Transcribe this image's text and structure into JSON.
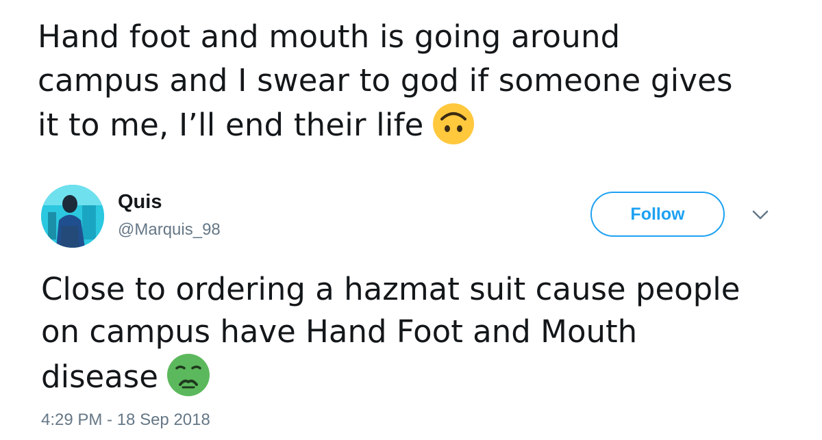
{
  "previous_tweet": {
    "lines": [
      "Hand foot and mouth is going around",
      "campus and I swear to god if someone gives",
      "it to me, I’ll end their life"
    ],
    "emoji": "upside-down-face-icon"
  },
  "reply": {
    "user": {
      "name": "Quis",
      "handle": "@Marquis_98"
    },
    "follow_label": "Follow",
    "menu_icon": "chevron-down-icon",
    "lines": [
      "Close to ordering a hazmat suit cause people",
      "on campus have Hand Foot and Mouth",
      "disease"
    ],
    "emoji": "nauseated-face-icon",
    "timestamp": "4:29 PM - 18 Sep 2018"
  },
  "colors": {
    "text": "#14171a",
    "secondary_text": "#657786",
    "accent": "#1da1f2",
    "emoji_yellow": "#ffc83d",
    "emoji_green": "#5cb85c"
  }
}
